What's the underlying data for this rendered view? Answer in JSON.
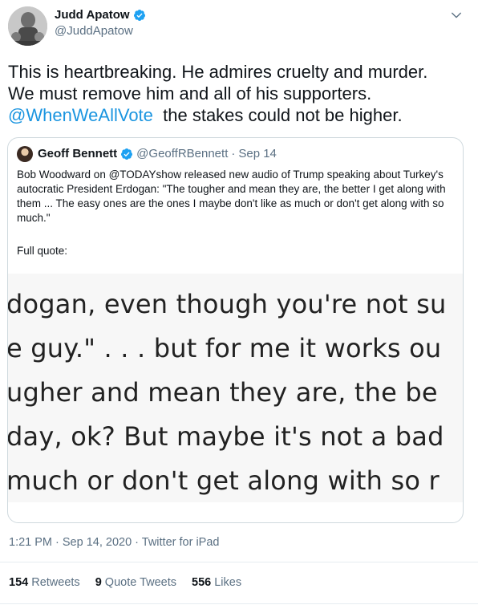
{
  "author": {
    "name": "Judd Apatow",
    "handle": "@JuddApatow",
    "verified": true
  },
  "tweet": {
    "text_line1": "This is heartbreaking.  He admires cruelty and murder.",
    "text_line2": "We must remove him and all of his supporters.",
    "mention": "@WhenWeAllVote",
    "text_line3_rest": "  the stakes could not be higher."
  },
  "quoted": {
    "name": "Geoff Bennett",
    "handle": "@GeoffRBennett",
    "separator": "·",
    "date": "Sep 14",
    "verified": true,
    "text": "Bob Woodward on @TODAYshow released new audio of Trump speaking about Turkey's autocratic President Erdogan: \"The tougher and mean they are, the better I get along with them ... The easy ones are the ones I maybe don't like as much or don't get along with so much.\"",
    "full_quote_label": "Full quote:",
    "image_lines": [
      "dogan, even though you're not su",
      "e guy.\" . . .  but for me it works ou",
      "ugher and mean they are, the be",
      "day, ok? But maybe it's not a bad",
      "much or don't get along with so r"
    ]
  },
  "meta": {
    "time": "1:21 PM · Sep 14, 2020 · Twitter for iPad"
  },
  "stats": {
    "retweets_count": "154",
    "retweets_label": "Retweets",
    "quote_count": "9",
    "quote_label": "Quote Tweets",
    "likes_count": "556",
    "likes_label": "Likes"
  },
  "icons": {
    "verified": "verified-badge-icon",
    "caret": "chevron-down-icon"
  },
  "colors": {
    "link": "#1b95e0",
    "verified": "#1da1f2",
    "secondary_text": "#5b7083"
  }
}
